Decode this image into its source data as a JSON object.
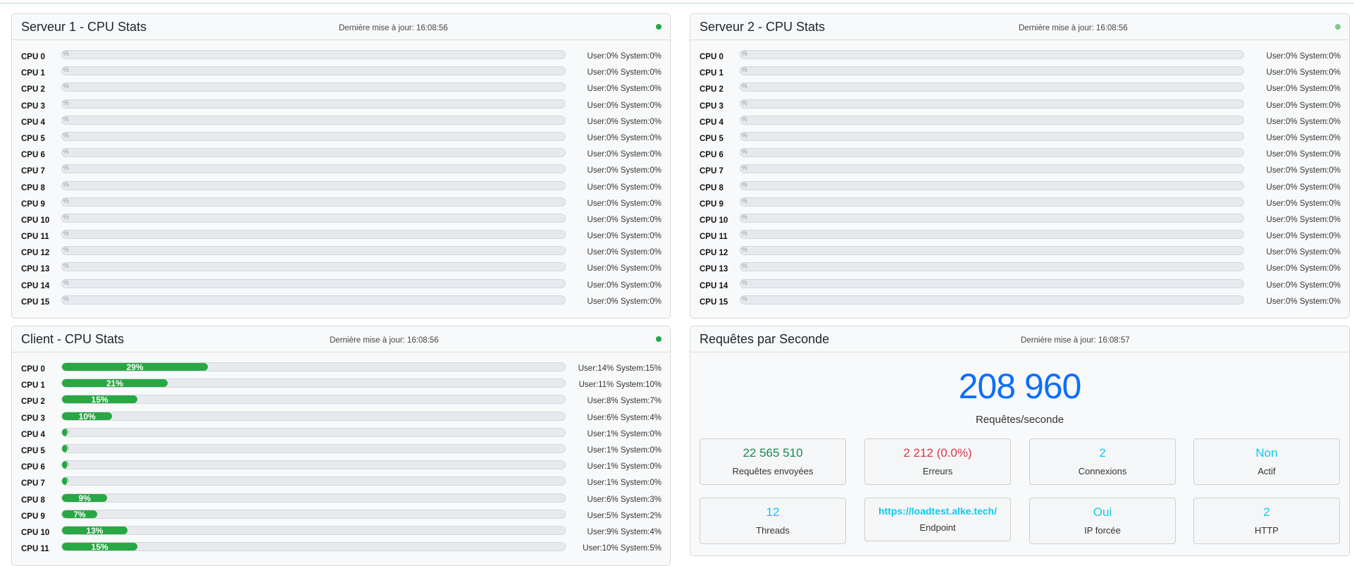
{
  "server1": {
    "title": "Serveur 1 - CPU Stats",
    "updated": "Dernière mise à jour: 16:08:56",
    "cpus": [
      {
        "label": "CPU 0",
        "percent": 0,
        "detail": "User:0% System:0%"
      },
      {
        "label": "CPU 1",
        "percent": 0,
        "detail": "User:0% System:0%"
      },
      {
        "label": "CPU 2",
        "percent": 0,
        "detail": "User:0% System:0%"
      },
      {
        "label": "CPU 3",
        "percent": 0,
        "detail": "User:0% System:0%"
      },
      {
        "label": "CPU 4",
        "percent": 0,
        "detail": "User:0% System:0%"
      },
      {
        "label": "CPU 5",
        "percent": 0,
        "detail": "User:0% System:0%"
      },
      {
        "label": "CPU 6",
        "percent": 0,
        "detail": "User:0% System:0%"
      },
      {
        "label": "CPU 7",
        "percent": 0,
        "detail": "User:0% System:0%"
      },
      {
        "label": "CPU 8",
        "percent": 0,
        "detail": "User:0% System:0%"
      },
      {
        "label": "CPU 9",
        "percent": 0,
        "detail": "User:0% System:0%"
      },
      {
        "label": "CPU 10",
        "percent": 0,
        "detail": "User:0% System:0%"
      },
      {
        "label": "CPU 11",
        "percent": 0,
        "detail": "User:0% System:0%"
      },
      {
        "label": "CPU 12",
        "percent": 0,
        "detail": "User:0% System:0%"
      },
      {
        "label": "CPU 13",
        "percent": 0,
        "detail": "User:0% System:0%"
      },
      {
        "label": "CPU 14",
        "percent": 0,
        "detail": "User:0% System:0%"
      },
      {
        "label": "CPU 15",
        "percent": 0,
        "detail": "User:0% System:0%"
      }
    ]
  },
  "server2": {
    "title": "Serveur 2 - CPU Stats",
    "updated": "Dernière mise à jour: 16:08:56",
    "cpus": [
      {
        "label": "CPU 0",
        "percent": 0,
        "detail": "User:0% System:0%"
      },
      {
        "label": "CPU 1",
        "percent": 0,
        "detail": "User:0% System:0%"
      },
      {
        "label": "CPU 2",
        "percent": 0,
        "detail": "User:0% System:0%"
      },
      {
        "label": "CPU 3",
        "percent": 0,
        "detail": "User:0% System:0%"
      },
      {
        "label": "CPU 4",
        "percent": 0,
        "detail": "User:0% System:0%"
      },
      {
        "label": "CPU 5",
        "percent": 0,
        "detail": "User:0% System:0%"
      },
      {
        "label": "CPU 6",
        "percent": 0,
        "detail": "User:0% System:0%"
      },
      {
        "label": "CPU 7",
        "percent": 0,
        "detail": "User:0% System:0%"
      },
      {
        "label": "CPU 8",
        "percent": 0,
        "detail": "User:0% System:0%"
      },
      {
        "label": "CPU 9",
        "percent": 0,
        "detail": "User:0% System:0%"
      },
      {
        "label": "CPU 10",
        "percent": 0,
        "detail": "User:0% System:0%"
      },
      {
        "label": "CPU 11",
        "percent": 0,
        "detail": "User:0% System:0%"
      },
      {
        "label": "CPU 12",
        "percent": 0,
        "detail": "User:0% System:0%"
      },
      {
        "label": "CPU 13",
        "percent": 0,
        "detail": "User:0% System:0%"
      },
      {
        "label": "CPU 14",
        "percent": 0,
        "detail": "User:0% System:0%"
      },
      {
        "label": "CPU 15",
        "percent": 0,
        "detail": "User:0% System:0%"
      }
    ]
  },
  "client": {
    "title": "Client - CPU Stats",
    "updated": "Dernière mise à jour: 16:08:56",
    "cpus": [
      {
        "label": "CPU 0",
        "percent": 29,
        "bar_text": "29%",
        "detail": "User:14% System:15%"
      },
      {
        "label": "CPU 1",
        "percent": 21,
        "bar_text": "21%",
        "detail": "User:11% System:10%"
      },
      {
        "label": "CPU 2",
        "percent": 15,
        "bar_text": "15%",
        "detail": "User:8% System:7%"
      },
      {
        "label": "CPU 3",
        "percent": 10,
        "bar_text": "10%",
        "detail": "User:6% System:4%"
      },
      {
        "label": "CPU 4",
        "percent": 1,
        "bar_text": "",
        "detail": "User:1% System:0%"
      },
      {
        "label": "CPU 5",
        "percent": 1,
        "bar_text": "",
        "detail": "User:1% System:0%"
      },
      {
        "label": "CPU 6",
        "percent": 1,
        "bar_text": "",
        "detail": "User:1% System:0%"
      },
      {
        "label": "CPU 7",
        "percent": 1,
        "bar_text": "",
        "detail": "User:1% System:0%"
      },
      {
        "label": "CPU 8",
        "percent": 9,
        "bar_text": "9%",
        "detail": "User:6% System:3%"
      },
      {
        "label": "CPU 9",
        "percent": 7,
        "bar_text": "7%",
        "detail": "User:5% System:2%"
      },
      {
        "label": "CPU 10",
        "percent": 13,
        "bar_text": "13%",
        "detail": "User:9% System:4%"
      },
      {
        "label": "CPU 11",
        "percent": 15,
        "bar_text": "15%",
        "detail": "User:10% System:5%"
      }
    ]
  },
  "rps": {
    "title": "Requêtes par Seconde",
    "updated": "Dernière mise à jour: 16:08:57",
    "value": "208 960",
    "caption": "Requêtes/seconde",
    "stats": [
      {
        "value": "22 565 510",
        "label": "Requêtes envoyées"
      },
      {
        "value": "2 212 (0.0%)",
        "label": "Erreurs"
      },
      {
        "value": "2",
        "label": "Connexions"
      },
      {
        "value": "Non",
        "label": "Actif"
      },
      {
        "value": "12",
        "label": "Threads"
      },
      {
        "value": "https://loadtest.alke.tech/",
        "label": "Endpoint"
      },
      {
        "value": "Oui",
        "label": "IP forcée"
      },
      {
        "value": "2",
        "label": "HTTP"
      }
    ]
  },
  "colors": {
    "bar_fill": "#28a745",
    "rps_blue": "#0d6efd",
    "stat_green": "#198754",
    "stat_red": "#dc3545",
    "stat_cyan": "#0dcaf0",
    "status_ok": "#28a745"
  }
}
